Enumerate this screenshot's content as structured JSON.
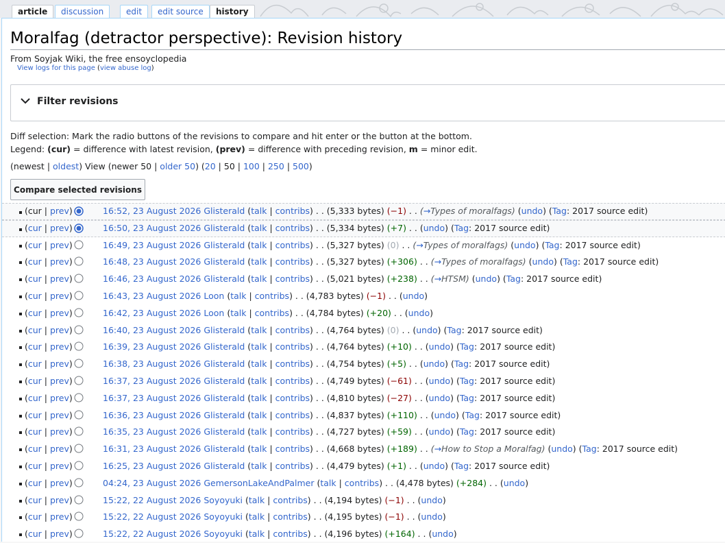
{
  "tabs": {
    "article": "article",
    "discussion": "discussion",
    "edit": "edit",
    "edit_source": "edit source",
    "history": "history"
  },
  "page": {
    "title": "Moralfag (detractor perspective): Revision history",
    "tagline": "From Soyjak Wiki, the free ensoyclopedia",
    "view_logs": "View logs for this page",
    "view_abuse_log": "view abuse log",
    "filter_title": "Filter revisions",
    "diff_help": "Diff selection: Mark the radio buttons of the revisions to compare and hit enter or the button at the bottom.",
    "legend_label": "Legend:",
    "legend_cur": "(cur)",
    "legend_cur_text": "= difference with latest revision,",
    "legend_prev": "(prev)",
    "legend_prev_text": "= difference with preceding revision,",
    "legend_m": "m",
    "legend_m_text": "= minor edit.",
    "nav_newest": "newest",
    "nav_oldest": "oldest",
    "nav_view": "View",
    "nav_newer": "newer 50",
    "nav_older": "older 50",
    "nav_20": "20",
    "nav_50": "50",
    "nav_100": "100",
    "nav_250": "250",
    "nav_500": "500",
    "compare_button": "Compare selected revisions"
  },
  "revisions": [
    {
      "cur": "cur",
      "prev": "prev",
      "ts": "16:52, 23 August 2026",
      "user": "Glisterald",
      "talk": "talk",
      "contribs": "contribs",
      "bytes": "5,333 bytes",
      "diff": "−1",
      "comment": "Types of moralfags",
      "undo": "undo",
      "tag": "Tag",
      "tagname": "2017 source edit"
    },
    {
      "cur": "cur",
      "prev": "prev",
      "ts": "16:50, 23 August 2026",
      "user": "Glisterald",
      "talk": "talk",
      "contribs": "contribs",
      "bytes": "5,334 bytes",
      "diff": "+7",
      "comment": "",
      "undo": "undo",
      "tag": "Tag",
      "tagname": "2017 source edit"
    },
    {
      "cur": "cur",
      "prev": "prev",
      "ts": "16:49, 23 August 2026",
      "user": "Glisterald",
      "talk": "talk",
      "contribs": "contribs",
      "bytes": "5,327 bytes",
      "diff": "0",
      "comment": "Types of moralfags",
      "undo": "undo",
      "tag": "Tag",
      "tagname": "2017 source edit"
    },
    {
      "cur": "cur",
      "prev": "prev",
      "ts": "16:48, 23 August 2026",
      "user": "Glisterald",
      "talk": "talk",
      "contribs": "contribs",
      "bytes": "5,327 bytes",
      "diff": "+306",
      "comment": "Types of moralfags",
      "undo": "undo",
      "tag": "Tag",
      "tagname": "2017 source edit"
    },
    {
      "cur": "cur",
      "prev": "prev",
      "ts": "16:46, 23 August 2026",
      "user": "Glisterald",
      "talk": "talk",
      "contribs": "contribs",
      "bytes": "5,021 bytes",
      "diff": "+238",
      "comment": "HTSM",
      "undo": "undo",
      "tag": "Tag",
      "tagname": "2017 source edit"
    },
    {
      "cur": "cur",
      "prev": "prev",
      "ts": "16:43, 23 August 2026",
      "user": "Loon",
      "talk": "talk",
      "contribs": "contribs",
      "bytes": "4,783 bytes",
      "diff": "−1",
      "comment": "",
      "undo": "undo",
      "tag": "",
      "tagname": ""
    },
    {
      "cur": "cur",
      "prev": "prev",
      "ts": "16:42, 23 August 2026",
      "user": "Loon",
      "talk": "talk",
      "contribs": "contribs",
      "bytes": "4,784 bytes",
      "diff": "+20",
      "comment": "",
      "undo": "undo",
      "tag": "",
      "tagname": ""
    },
    {
      "cur": "cur",
      "prev": "prev",
      "ts": "16:40, 23 August 2026",
      "user": "Glisterald",
      "talk": "talk",
      "contribs": "contribs",
      "bytes": "4,764 bytes",
      "diff": "0",
      "comment": "",
      "undo": "undo",
      "tag": "Tag",
      "tagname": "2017 source edit"
    },
    {
      "cur": "cur",
      "prev": "prev",
      "ts": "16:39, 23 August 2026",
      "user": "Glisterald",
      "talk": "talk",
      "contribs": "contribs",
      "bytes": "4,764 bytes",
      "diff": "+10",
      "comment": "",
      "undo": "undo",
      "tag": "Tag",
      "tagname": "2017 source edit"
    },
    {
      "cur": "cur",
      "prev": "prev",
      "ts": "16:38, 23 August 2026",
      "user": "Glisterald",
      "talk": "talk",
      "contribs": "contribs",
      "bytes": "4,754 bytes",
      "diff": "+5",
      "comment": "",
      "undo": "undo",
      "tag": "Tag",
      "tagname": "2017 source edit"
    },
    {
      "cur": "cur",
      "prev": "prev",
      "ts": "16:37, 23 August 2026",
      "user": "Glisterald",
      "talk": "talk",
      "contribs": "contribs",
      "bytes": "4,749 bytes",
      "diff": "−61",
      "comment": "",
      "undo": "undo",
      "tag": "Tag",
      "tagname": "2017 source edit"
    },
    {
      "cur": "cur",
      "prev": "prev",
      "ts": "16:37, 23 August 2026",
      "user": "Glisterald",
      "talk": "talk",
      "contribs": "contribs",
      "bytes": "4,810 bytes",
      "diff": "−27",
      "comment": "",
      "undo": "undo",
      "tag": "Tag",
      "tagname": "2017 source edit"
    },
    {
      "cur": "cur",
      "prev": "prev",
      "ts": "16:36, 23 August 2026",
      "user": "Glisterald",
      "talk": "talk",
      "contribs": "contribs",
      "bytes": "4,837 bytes",
      "diff": "+110",
      "comment": "",
      "undo": "undo",
      "tag": "Tag",
      "tagname": "2017 source edit"
    },
    {
      "cur": "cur",
      "prev": "prev",
      "ts": "16:35, 23 August 2026",
      "user": "Glisterald",
      "talk": "talk",
      "contribs": "contribs",
      "bytes": "4,727 bytes",
      "diff": "+59",
      "comment": "",
      "undo": "undo",
      "tag": "Tag",
      "tagname": "2017 source edit"
    },
    {
      "cur": "cur",
      "prev": "prev",
      "ts": "16:31, 23 August 2026",
      "user": "Glisterald",
      "talk": "talk",
      "contribs": "contribs",
      "bytes": "4,668 bytes",
      "diff": "+189",
      "comment": "How to Stop a Moralfag",
      "undo": "undo",
      "tag": "Tag",
      "tagname": "2017 source edit"
    },
    {
      "cur": "cur",
      "prev": "prev",
      "ts": "16:25, 23 August 2026",
      "user": "Glisterald",
      "talk": "talk",
      "contribs": "contribs",
      "bytes": "4,479 bytes",
      "diff": "+1",
      "comment": "",
      "undo": "undo",
      "tag": "Tag",
      "tagname": "2017 source edit"
    },
    {
      "cur": "cur",
      "prev": "prev",
      "ts": "04:24, 23 August 2026",
      "user": "GemersonLakeAndPalmer",
      "talk": "talk",
      "contribs": "contribs",
      "bytes": "4,478 bytes",
      "diff": "+284",
      "comment": "",
      "undo": "undo",
      "tag": "",
      "tagname": ""
    },
    {
      "cur": "cur",
      "prev": "prev",
      "ts": "15:22, 22 August 2026",
      "user": "Soyoyuki",
      "talk": "talk",
      "contribs": "contribs",
      "bytes": "4,194 bytes",
      "diff": "−1",
      "comment": "",
      "undo": "undo",
      "tag": "",
      "tagname": ""
    },
    {
      "cur": "cur",
      "prev": "prev",
      "ts": "15:22, 22 August 2026",
      "user": "Soyoyuki",
      "talk": "talk",
      "contribs": "contribs",
      "bytes": "4,195 bytes",
      "diff": "−1",
      "comment": "",
      "undo": "undo",
      "tag": "",
      "tagname": ""
    },
    {
      "cur": "cur",
      "prev": "prev",
      "ts": "15:22, 22 August 2026",
      "user": "Soyoyuki",
      "talk": "talk",
      "contribs": "contribs",
      "bytes": "4,196 bytes",
      "diff": "+164",
      "comment": "",
      "undo": "undo",
      "tag": "",
      "tagname": ""
    }
  ]
}
